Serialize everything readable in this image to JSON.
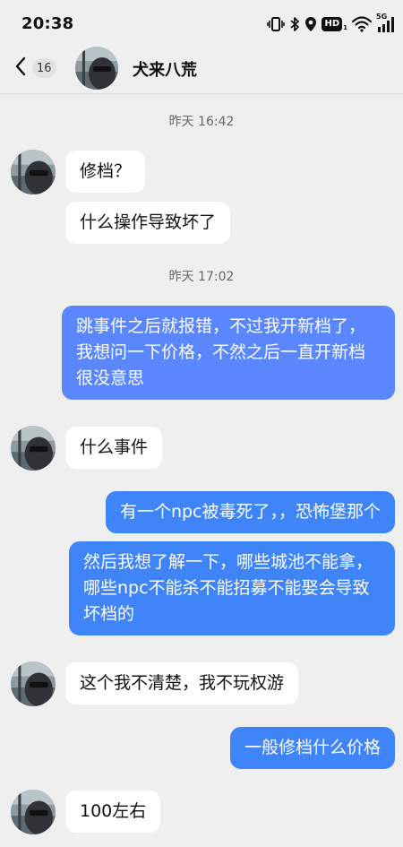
{
  "status_bar": {
    "time": "20:38",
    "hd_label": "HD",
    "hd_sub": "1",
    "network_label": "5G"
  },
  "nav": {
    "unread_count": "16",
    "contact_name": "犬来八荒"
  },
  "messages": {
    "ts1": "昨天 16:42",
    "m1": "修档？",
    "m2": "什么操作导致坏了",
    "ts2": "昨天 17:02",
    "m3": "跳事件之后就报错，不过我开新档了，我想问一下价格，不然之后一直开新档很没意思",
    "m4": "什么事件",
    "m5": "有一个npc被毒死了，，恐怖堡那个",
    "m6": "然后我想了解一下，哪些城池不能拿，哪些npc不能杀不能招募不能娶会导致坏档的",
    "m7": "这个我不清楚，我不玩权游",
    "m8": "一般修档什么价格",
    "m9": "100左右"
  },
  "colors": {
    "background": "#efefef",
    "incoming_bubble": "#ffffff",
    "outgoing_bubble": "#5a86ff",
    "outgoing_bubble_alt": "#3f84f9",
    "timestamp_text": "#666666"
  }
}
